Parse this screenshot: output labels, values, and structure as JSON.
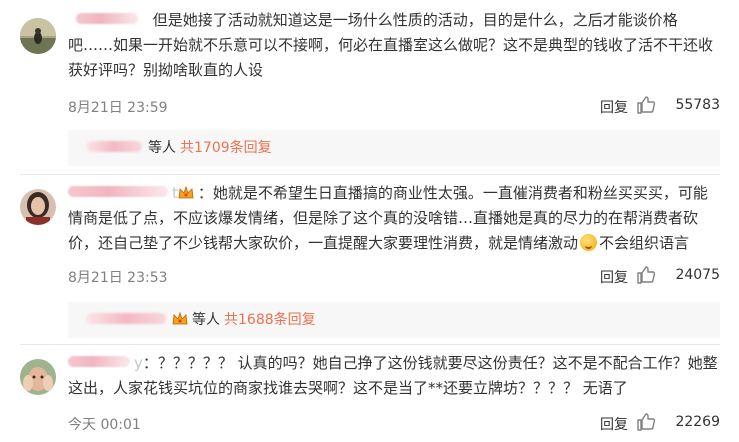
{
  "comments": [
    {
      "text": "但是她接了活动就知道这是一场什么性质的活动，目的是什么，之后才能谈价格吧……如果一开始就不乐意可以不接啊，何必在直播室这么做呢？这不是典型的钱收了活不干还收获好评吗？别拗啥耿直的人设",
      "time": "8月21日 23:59",
      "reply_label": "回复",
      "likes": "55783",
      "subreplies": {
        "label": "等人",
        "total": "共1709条回复"
      }
    },
    {
      "username_suffix": "t",
      "text_part1": "她就是不希望生日直播搞的商业性太强。一直催消费者和粉丝买买买，可能情商是低了点，不应该爆发情绪，但是除了这个真的没啥错…直播她是真的尽力的在帮消费者砍价，还自己垫了不少钱帮大家砍价，一直提醒大家要理性消费，就是情绪激动",
      "text_part2": "不会组织语言",
      "time": "8月21日 23:53",
      "reply_label": "回复",
      "likes": "24075",
      "subreplies": {
        "label": "等人",
        "total": "共1688条回复"
      }
    },
    {
      "username_suffix": "y",
      "text": "：？？？？？ 认真的吗？她自己挣了这份钱就要尽这份责任？这不是不配合工作？她整这出，人家花钱买坑位的商家找谁去哭啊？这不是当了**还要立牌坊？？？？ 无语了",
      "time": "今天 00:01",
      "reply_label": "回复",
      "likes": "22269"
    }
  ],
  "icons": {
    "like": "thumbs-up-icon",
    "emoji": "emoji-laugh-icon",
    "badge": "vip-crown-icon"
  },
  "colors": {
    "accent": "#eb7350",
    "time": "#808080",
    "subreply_bg": "#f7f7f7"
  }
}
